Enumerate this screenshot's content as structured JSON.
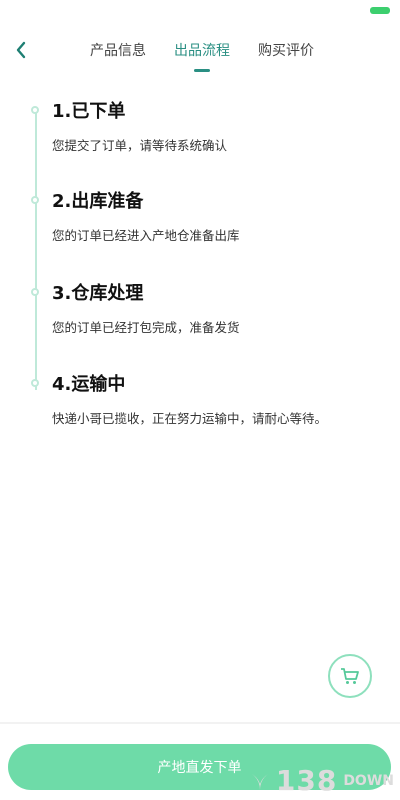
{
  "nav": {
    "tabs": [
      {
        "label": "产品信息",
        "active": false
      },
      {
        "label": "出品流程",
        "active": true
      },
      {
        "label": "购买评价",
        "active": false
      }
    ]
  },
  "timeline": {
    "steps": [
      {
        "title": "1.已下单",
        "desc": "您提交了订单，请等待系统确认"
      },
      {
        "title": "2.出库准备",
        "desc": "您的订单已经进入产地仓准备出库"
      },
      {
        "title": "3.仓库处理",
        "desc": "您的订单已经打包完成，准备发货"
      },
      {
        "title": "4.运输中",
        "desc": "快递小哥已揽收，正在努力运输中，请耐心等待。"
      }
    ]
  },
  "bottom": {
    "order_button_label": "产地直发下单"
  },
  "watermark": {
    "text_big": "138",
    "text_small": "DOWN"
  },
  "colors": {
    "accent": "#2a8f83",
    "button": "#6edba8",
    "timeline": "#bfe9d9"
  }
}
